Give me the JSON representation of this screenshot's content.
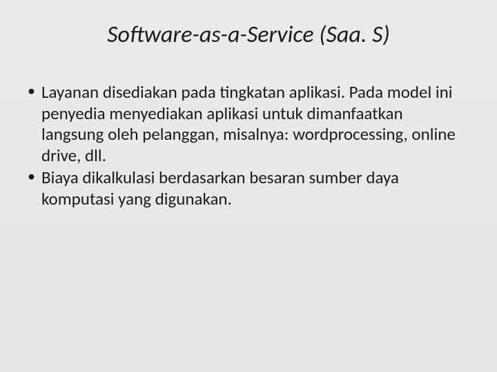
{
  "slide": {
    "title": "Software-as-a-Service (Saa. S)",
    "bullets": [
      "Layanan disediakan pada tingkatan aplikasi. Pada model ini penyedia menyediakan aplikasi untuk dimanfaatkan langsung oleh pelanggan, misalnya: wordprocessing, online drive, dll.",
      "Biaya dikalkulasi berdasarkan besaran sumber daya komputasi yang digunakan."
    ]
  }
}
